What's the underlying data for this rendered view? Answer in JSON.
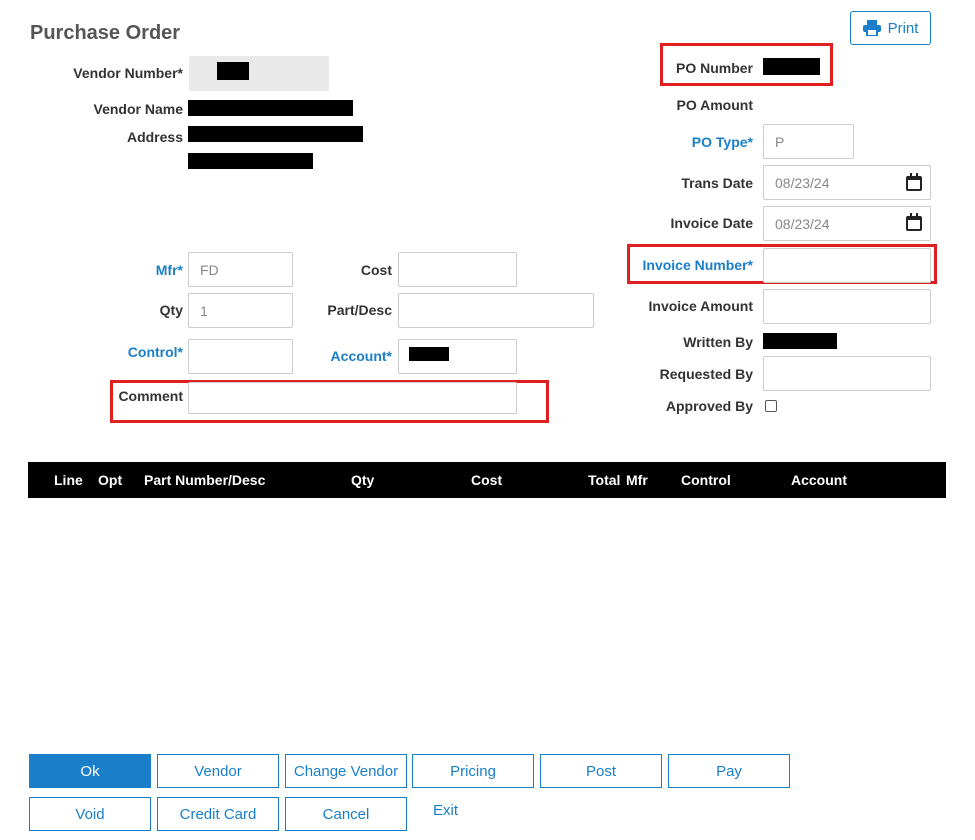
{
  "page": {
    "title": "Purchase Order"
  },
  "print_label": "Print",
  "vendor": {
    "number_label": "Vendor Number*",
    "name_label": "Vendor Name",
    "address_label": "Address"
  },
  "po": {
    "number_label": "PO Number",
    "amount_label": "PO Amount",
    "type_label": "PO Type*",
    "type_value": "P",
    "trans_date_label": "Trans Date",
    "trans_date_value": "08/23/24",
    "invoice_date_label": "Invoice Date",
    "invoice_date_value": "08/23/24",
    "invoice_number_label": "Invoice Number*",
    "invoice_amount_label": "Invoice Amount",
    "written_by_label": "Written By",
    "requested_by_label": "Requested By",
    "approved_by_label": "Approved By"
  },
  "line_entry": {
    "mfr_label": "Mfr*",
    "mfr_value": "FD",
    "cost_label": "Cost",
    "qty_label": "Qty",
    "qty_value": "1",
    "part_label": "Part/Desc",
    "control_label": "Control*",
    "account_label": "Account*",
    "comment_label": "Comment"
  },
  "grid": {
    "columns": [
      "Line",
      "Opt",
      "Part Number/Desc",
      "Qty",
      "Cost",
      "Total",
      "Mfr",
      "Control",
      "Account"
    ]
  },
  "buttons": {
    "ok": "Ok",
    "vendor": "Vendor",
    "change_vendor": "Change Vendor",
    "pricing": "Pricing",
    "post": "Post",
    "pay": "Pay",
    "void": "Void",
    "credit_card": "Credit Card",
    "cancel": "Cancel",
    "exit": "Exit"
  },
  "colors": {
    "accent": "#1a7fc8",
    "highlight": "#e02020",
    "header": "#000000"
  }
}
